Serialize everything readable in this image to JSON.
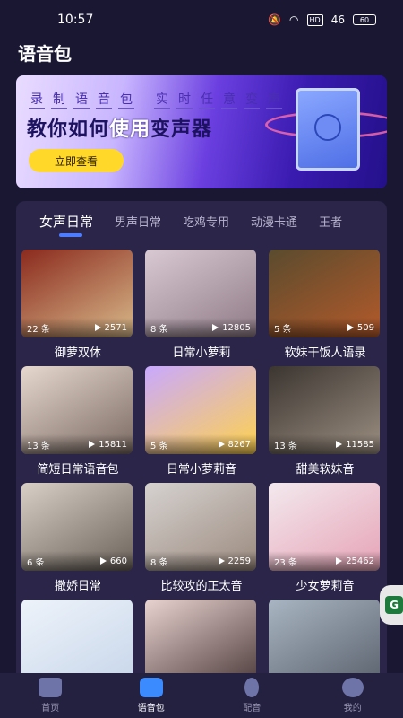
{
  "status_bar": {
    "time": "10:57",
    "hd": "HD",
    "signal": "46",
    "battery": "60"
  },
  "page_title": "语音包",
  "banner": {
    "chars": [
      "录",
      "制",
      "语",
      "音",
      "包",
      "",
      "实",
      "时",
      "任",
      "意",
      "变",
      "声"
    ],
    "headline_pre": "教你如何",
    "headline_hl": "使用",
    "headline_post": "变声器",
    "cta_label": "立即查看"
  },
  "tabs": [
    "女声日常",
    "男声日常",
    "吃鸡专用",
    "动漫卡通",
    "王者"
  ],
  "cards": [
    {
      "title": "御萝双休",
      "count": "22 条",
      "plays": "2571",
      "colors": [
        "#8b2a1e",
        "#d8b98a"
      ]
    },
    {
      "title": "日常小萝莉",
      "count": "8 条",
      "plays": "12805",
      "colors": [
        "#d9c9d2",
        "#8e7a86"
      ]
    },
    {
      "title": "软妹干饭人语录",
      "count": "5 条",
      "plays": "509",
      "colors": [
        "#5a4b2e",
        "#b45a2a"
      ]
    },
    {
      "title": "简短日常语音包",
      "count": "13 条",
      "plays": "15811",
      "colors": [
        "#e6d7cf",
        "#7a6a62"
      ]
    },
    {
      "title": "日常小萝莉音",
      "count": "5 条",
      "plays": "8267",
      "colors": [
        "#c9a9ff",
        "#ffd24d"
      ]
    },
    {
      "title": "甜美软妹音",
      "count": "13 条",
      "plays": "11585",
      "colors": [
        "#3b3530",
        "#9c8f82"
      ]
    },
    {
      "title": "撒娇日常",
      "count": "6 条",
      "plays": "660",
      "colors": [
        "#d8d0c6",
        "#6b625a"
      ]
    },
    {
      "title": "比较攻的正太音",
      "count": "8 条",
      "plays": "2259",
      "colors": [
        "#d6d2d0",
        "#9b8a7e"
      ]
    },
    {
      "title": "少女萝莉音",
      "count": "23 条",
      "plays": "25462",
      "colors": [
        "#f3e9ee",
        "#e6a3b6"
      ]
    },
    {
      "title": "",
      "count": "",
      "plays": "",
      "colors": [
        "#eef3fa",
        "#c7d6ea"
      ]
    },
    {
      "title": "",
      "count": "",
      "plays": "",
      "colors": [
        "#e9d3d0",
        "#4b3a3a"
      ]
    },
    {
      "title": "",
      "count": "",
      "plays": "",
      "colors": [
        "#a9b5c2",
        "#59616c"
      ]
    }
  ],
  "nav": [
    {
      "label": "首页",
      "icon": "home-icon"
    },
    {
      "label": "语音包",
      "icon": "voice-pack-icon"
    },
    {
      "label": "配音",
      "icon": "microphone-icon"
    },
    {
      "label": "我的",
      "icon": "profile-icon"
    }
  ],
  "float_button": "G",
  "theme": {
    "background": "#1a1733",
    "panel": "#2b2649",
    "accent": "#4d7cff",
    "cta": "#ffd829"
  }
}
